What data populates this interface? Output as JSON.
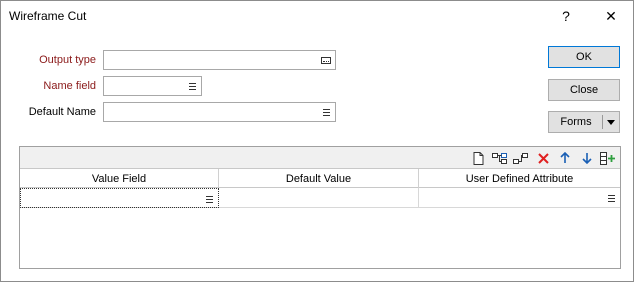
{
  "window": {
    "title": "Wireframe Cut",
    "help_label": "?",
    "close_label": "✕"
  },
  "form": {
    "output_type": {
      "label": "Output type",
      "value": ""
    },
    "name_field": {
      "label": "Name field",
      "value": ""
    },
    "default_name": {
      "label": "Default Name",
      "value": ""
    }
  },
  "buttons": {
    "ok": "OK",
    "close": "Close",
    "forms": "Forms"
  },
  "grid": {
    "toolbar": {
      "new_icon": "new-document-icon",
      "insert_icon": "insert-row-icon",
      "append_icon": "append-row-icon",
      "delete_icon": "delete-icon",
      "move_up_icon": "move-up-icon",
      "move_down_icon": "move-down-icon",
      "add_column_icon": "add-column-icon"
    },
    "columns": [
      "Value Field",
      "Default Value",
      "User Defined Attribute"
    ],
    "rows": [
      [
        "",
        "",
        ""
      ]
    ]
  },
  "colors": {
    "required_label": "#8b1a1a",
    "ok_border": "#0078d7",
    "delete_icon": "#e02020",
    "arrow_icon": "#1a5fb4",
    "add_icon": "#2e9e3e"
  }
}
